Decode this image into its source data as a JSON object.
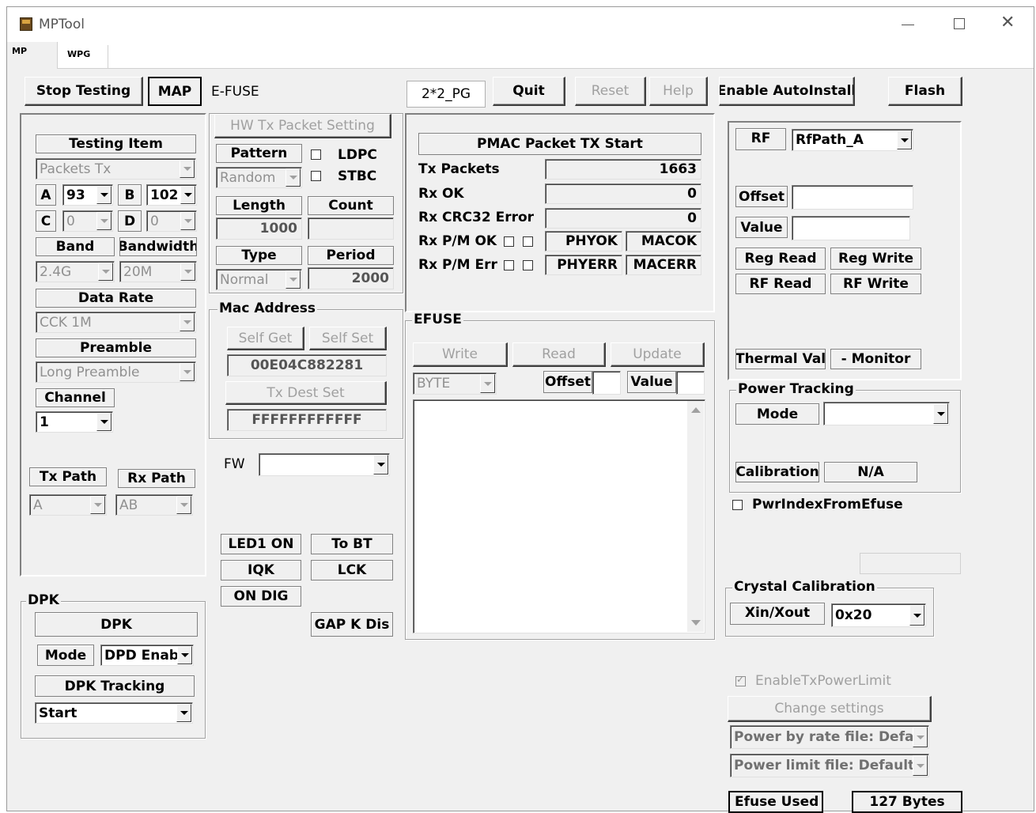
{
  "window": {
    "title": "MPTool",
    "app_icon": "app-icon",
    "controls": [
      "minimize",
      "maximize",
      "close"
    ]
  },
  "tabs": [
    "MP",
    "WPG"
  ],
  "toolbar": {
    "stop_testing": "Stop Testing",
    "map": "MAP",
    "efuse": "E-FUSE",
    "pg": "2*2_PG",
    "quit": "Quit",
    "reset": "Reset",
    "help": "Help",
    "enable_autoinstall": "Enable AutoInstall",
    "flash": "Flash"
  },
  "testing": {
    "title": "Testing Item",
    "item": "Packets Tx",
    "a_label": "A",
    "a_value": "93",
    "b_label": "B",
    "b_value": "102",
    "c_label": "C",
    "c_value": "0",
    "d_label": "D",
    "d_value": "0",
    "band_label": "Band",
    "band_value": "2.4G",
    "bandwidth_label": "Bandwidth",
    "bandwidth_value": "20M",
    "rate_label": "Data Rate",
    "rate_value": "CCK 1M",
    "preamble_label": "Preamble",
    "preamble_value": "Long Preamble",
    "channel_label": "Channel",
    "channel_value": "1",
    "tx_path_label": "Tx Path",
    "tx_path_value": "A",
    "rx_path_label": "Rx Path",
    "rx_path_value": "AB"
  },
  "dpk": {
    "title": "DPK",
    "button": "DPK",
    "mode_label": "Mode",
    "mode_value": "DPD Enab",
    "tracking_label": "DPK Tracking",
    "tracking_value": "Start"
  },
  "hw": {
    "title": "HW Tx Packet Setting",
    "pattern_label": "Pattern",
    "pattern_value": "Random",
    "ldpc": "LDPC",
    "stbc": "STBC",
    "length_label": "Length",
    "count_label": "Count",
    "length_value": "1000",
    "count_value": "",
    "type_label": "Type",
    "period_label": "Period",
    "type_value": "Normal",
    "period_value": "2000"
  },
  "mac": {
    "title": "Mac Address",
    "self_get": "Self Get",
    "self_set": "Self Set",
    "address": "00E04C882281",
    "dest_set": "Tx Dest Set",
    "dest_value": "FFFFFFFFFFFF"
  },
  "fw": {
    "label": "FW",
    "value": ""
  },
  "misc_buttons": {
    "led1": "LED1 ON",
    "to_bt": "To BT",
    "iqk": "IQK",
    "lck": "LCK",
    "on_dig": "ON DIG",
    "gap": "GAP K Dis"
  },
  "pmac": {
    "title": "PMAC Packet TX Start",
    "tx_packets_label": "Tx Packets",
    "tx_packets": "1663",
    "rx_ok_label": "Rx OK",
    "rx_ok": "0",
    "crc_label": "Rx CRC32 Error",
    "crc": "0",
    "pm_ok_label": "Rx P/M OK",
    "phyok": "PHYOK",
    "macok": "MACOK",
    "pm_err_label": "Rx P/M Err",
    "phyerr": "PHYERR",
    "macerr": "MACERR"
  },
  "efuse": {
    "title": "EFUSE",
    "write": "Write",
    "read": "Read",
    "update": "Update",
    "unit": "BYTE",
    "offset_label": "Offset",
    "value_label": "Value"
  },
  "rf": {
    "label": "RF",
    "path": "RfPath_A",
    "offset_label": "Offset",
    "value_label": "Value",
    "reg_read": "Reg Read",
    "reg_write": "Reg Write",
    "rf_read": "RF Read",
    "rf_write": "RF Write",
    "thermal": "Thermal Val",
    "monitor": "- Monitor"
  },
  "power_tracking": {
    "title": "Power Tracking",
    "mode_label": "Mode",
    "mode_value": "",
    "calibration_label": "Calibration",
    "calibration_value": "N/A"
  },
  "pwr_index": "PwrIndexFromEfuse",
  "crystal": {
    "title": "Crystal Calibration",
    "label": "Xin/Xout",
    "value": "0x20"
  },
  "power_limit": {
    "enable": "EnableTxPowerLimit",
    "change": "Change settings",
    "rate_file": "Power by rate file: Defaul",
    "limit_file": "Power limit file: Default"
  },
  "efuse_used": {
    "label": "Efuse Used",
    "value": "127 Bytes"
  }
}
